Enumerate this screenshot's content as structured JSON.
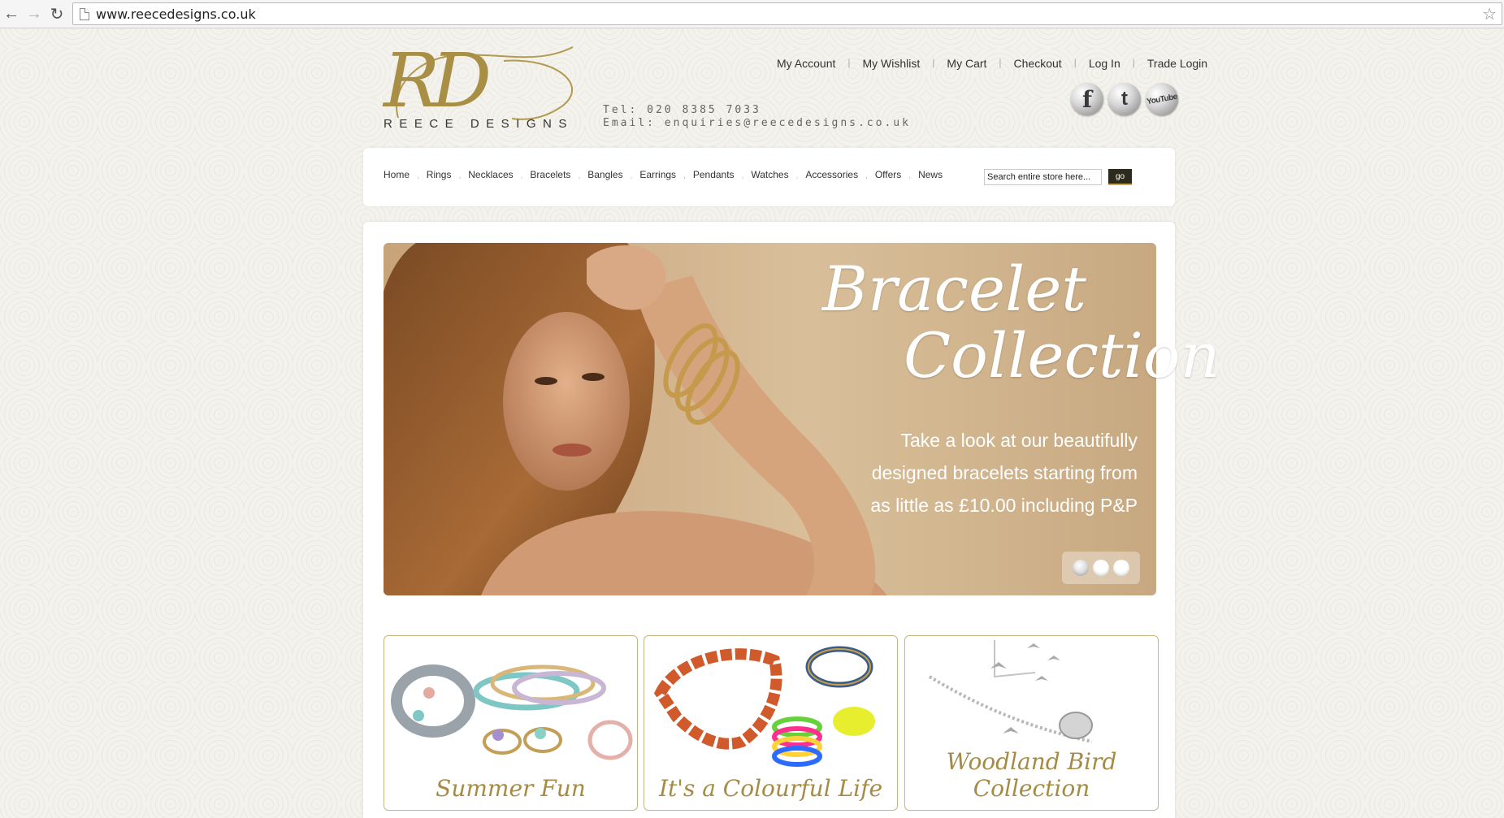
{
  "browser": {
    "url": "www.reecedesigns.co.uk"
  },
  "logo": {
    "monogram": "RD",
    "name": "REECE DESIGNS"
  },
  "contact": {
    "tel": "Tel: 020 8385 7033",
    "email": "Email: enquiries@reecedesigns.co.uk"
  },
  "toplinks": [
    "My Account",
    "My Wishlist",
    "My Cart",
    "Checkout",
    "Log In",
    "Trade Login"
  ],
  "social": [
    {
      "name": "facebook-icon",
      "glyph": "f"
    },
    {
      "name": "twitter-icon",
      "glyph": "t"
    },
    {
      "name": "youtube-icon",
      "glyph": "YouTube"
    }
  ],
  "menu": [
    "Home",
    "Rings",
    "Necklaces",
    "Bracelets",
    "Bangles",
    "Earrings",
    "Pendants",
    "Watches",
    "Accessories",
    "Offers",
    "News"
  ],
  "search": {
    "value": "Search entire store here...",
    "button": "go"
  },
  "banner": {
    "title_line1": "Bracelet",
    "title_line2": "Collection",
    "line1": "Take a look at our beautifully",
    "line2": "designed bracelets starting from",
    "line3": "as little as £10.00 including P&P",
    "slides": 3,
    "active_slide": 1
  },
  "promos": [
    {
      "caption": "Summer Fun"
    },
    {
      "caption": "It's a Colourful Life"
    },
    {
      "caption": "Woodland Bird Collection"
    }
  ]
}
